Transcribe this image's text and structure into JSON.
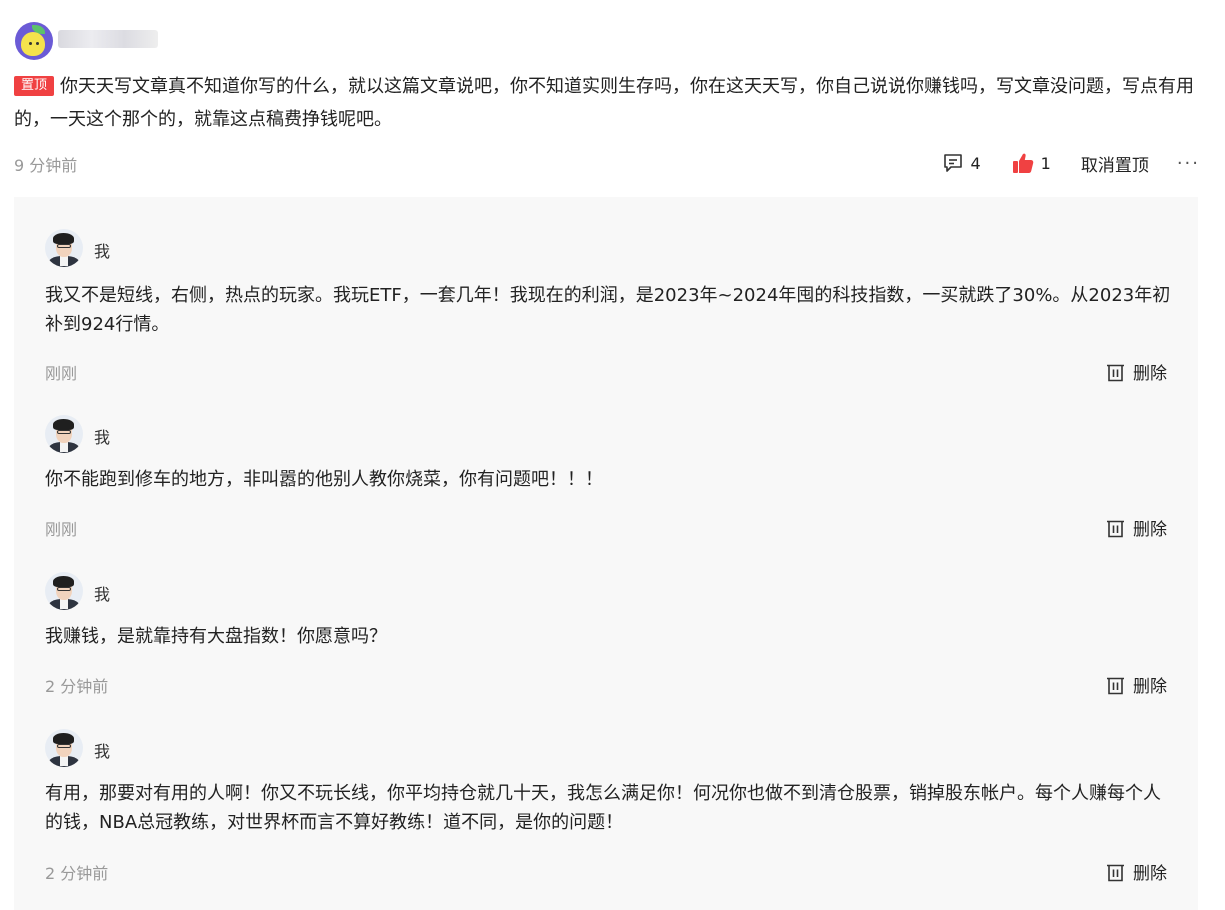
{
  "main_comment": {
    "pin_label": "置顶",
    "text": "你天天写文章真不知道你写的什么，就以这篇文章说吧，你不知道实则生存吗，你在这天天写，你自己说说你赚钱吗，写文章没问题，写点有用的，一天这个那个的，就靠这点稿费挣钱呢吧。",
    "time": "9 分钟前",
    "reply_count": "4",
    "like_count": "1",
    "unpin_label": "取消置顶",
    "more_label": "···",
    "colors": {
      "pin_badge": "#f04142",
      "like_icon": "#f04142"
    }
  },
  "replies": [
    {
      "name": "我",
      "text": "我又不是短线，右侧，热点的玩家。我玩ETF，一套几年！我现在的利润，是2023年~2024年囤的科技指数，一买就跌了30%。从2023年初补到924行情。",
      "time": "刚刚",
      "delete_label": "删除"
    },
    {
      "name": "我",
      "text": "你不能跑到修车的地方，非叫嚣的他别人教你烧菜，你有问题吧！！！",
      "time": "刚刚",
      "delete_label": "删除"
    },
    {
      "name": "我",
      "text": "我赚钱，是就靠持有大盘指数！你愿意吗？",
      "time": "2 分钟前",
      "delete_label": "删除"
    },
    {
      "name": "我",
      "text": "有用，那要对有用的人啊！你又不玩长线，你平均持仓就几十天，我怎么满足你！何况你也做不到清仓股票，销掉股东帐户。每个人赚每个人的钱，NBA总冠教练，对世界杯而言不算好教练！道不同，是你的问题！",
      "time": "2 分钟前",
      "delete_label": "删除"
    }
  ],
  "icons": {
    "top_avatar": "lemon-avatar-icon",
    "reply": "comment-icon",
    "like": "thumbs-up-icon",
    "delete": "trash-icon",
    "reply_avatar": "user-photo-avatar"
  }
}
